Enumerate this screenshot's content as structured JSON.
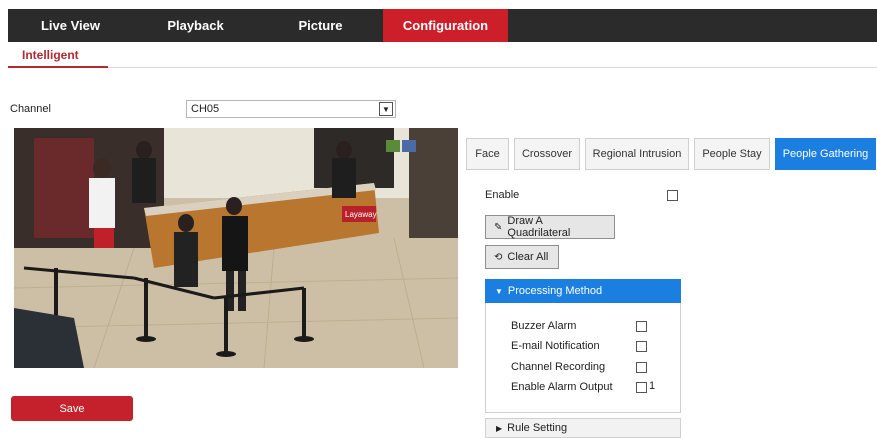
{
  "nav": {
    "items": [
      {
        "label": "Live View"
      },
      {
        "label": "Playback"
      },
      {
        "label": "Picture"
      },
      {
        "label": "Configuration"
      }
    ]
  },
  "subnav": {
    "label": "Intelligent"
  },
  "channel": {
    "label": "Channel",
    "value": "CH05"
  },
  "video": {
    "caption": "Layaway"
  },
  "save_label": "Save",
  "tabs": [
    {
      "label": "Face"
    },
    {
      "label": "Crossover"
    },
    {
      "label": "Regional Intrusion"
    },
    {
      "label": "People Stay"
    },
    {
      "label": "People Gathering"
    }
  ],
  "panel": {
    "enable_label": "Enable",
    "draw_label": "Draw A Quadrilateral",
    "clear_label": "Clear All",
    "processing_title": "Processing Method",
    "options": [
      {
        "label": "Buzzer Alarm"
      },
      {
        "label": "E-mail Notification"
      },
      {
        "label": "Channel Recording"
      },
      {
        "label": "Enable Alarm Output",
        "suffix": "1"
      }
    ],
    "rule_title": "Rule Setting"
  },
  "colors": {
    "accent_red": "#cc1f2a",
    "accent_blue": "#1a7fe0",
    "nav_bg": "#2b2b2b"
  }
}
